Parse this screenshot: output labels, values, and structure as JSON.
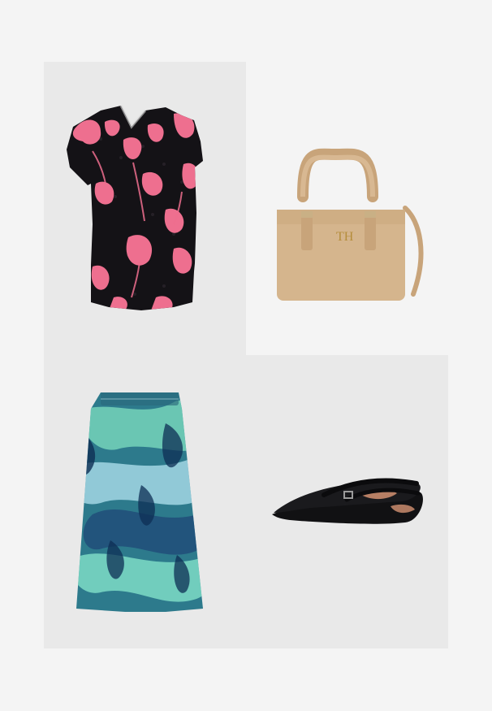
{
  "outfit": {
    "items": [
      {
        "id": "top",
        "icon": "floral-blouse-image",
        "colors": {
          "base": "#141216",
          "accent": "#ee6f8f"
        }
      },
      {
        "id": "bag",
        "icon": "tan-handbag-image",
        "colors": {
          "base": "#d5b58d",
          "accent": "#c8a47a"
        }
      },
      {
        "id": "skirt",
        "icon": "printed-skirt-image",
        "colors": {
          "base": "#2d7a8c",
          "accent": "#7fe0c0"
        }
      },
      {
        "id": "shoe",
        "icon": "black-flat-shoe-image",
        "colors": {
          "base": "#111113",
          "accent": "#c98b6d"
        }
      }
    ]
  }
}
